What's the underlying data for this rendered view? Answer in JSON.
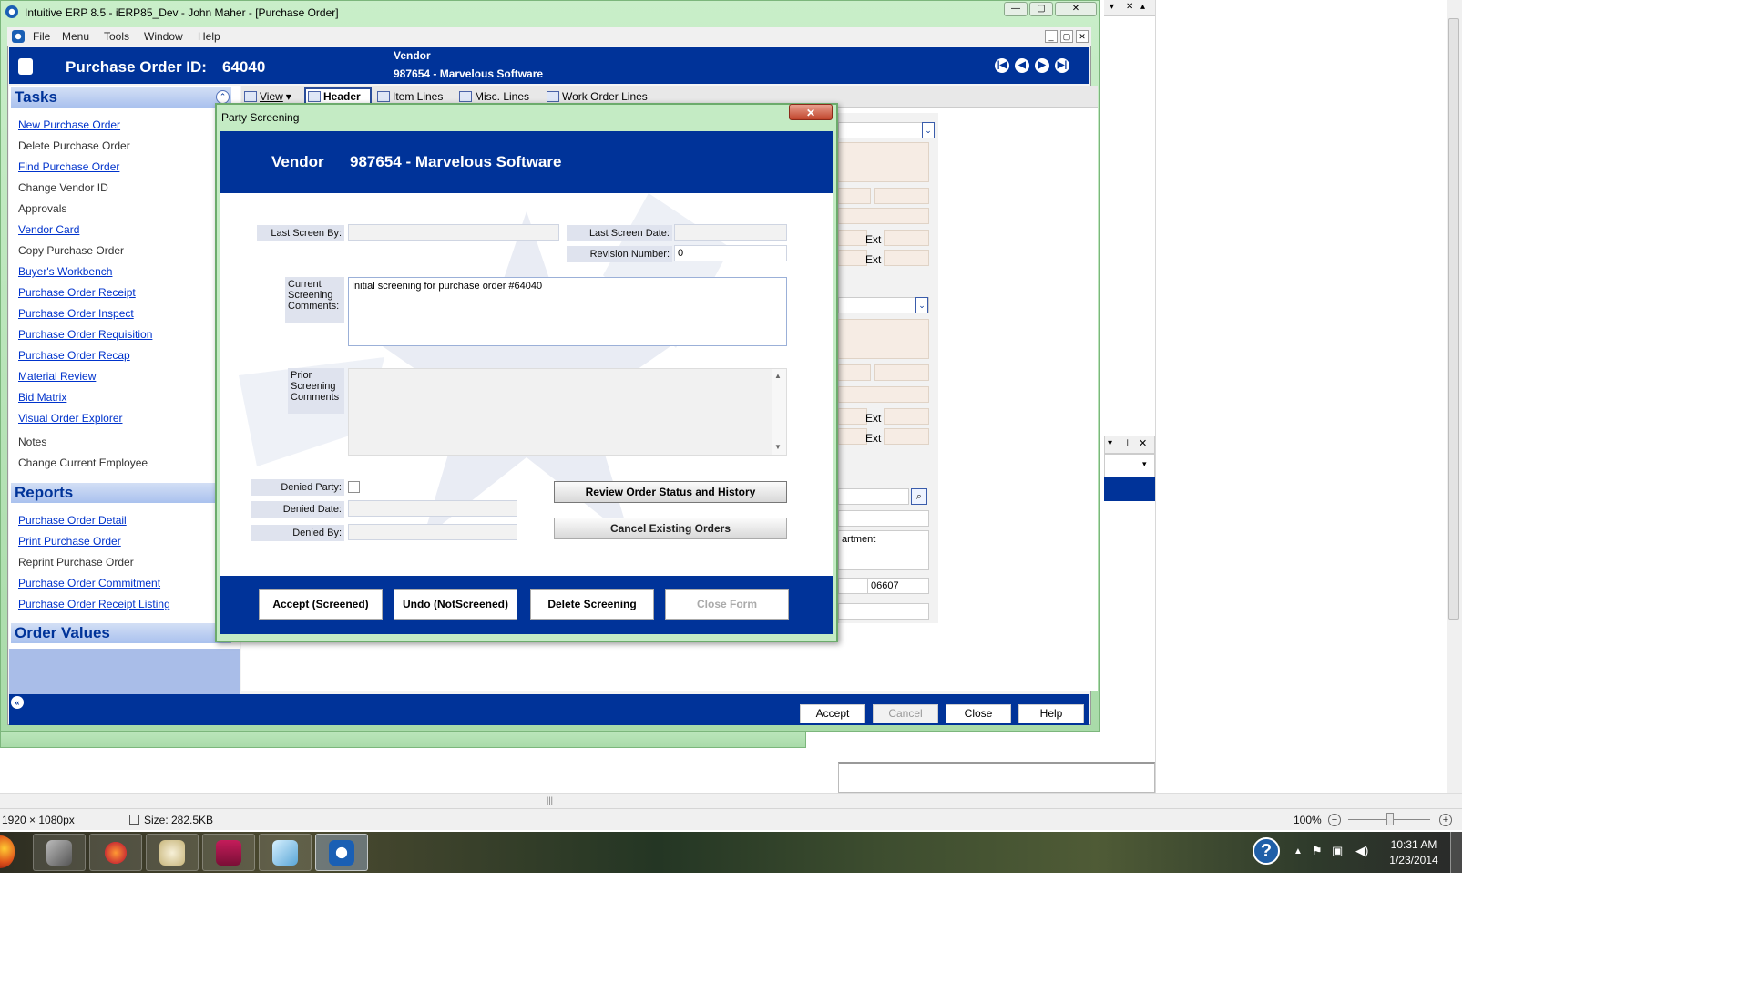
{
  "erp": {
    "window_title": "Intuitive ERP 8.5 - iERP85_Dev - John Maher - [Purchase Order]",
    "menu": [
      "File",
      "Menu",
      "Tools",
      "Window",
      "Help"
    ],
    "po_id_label": "Purchase Order ID:",
    "po_id": "64040",
    "vendor_label": "Vendor",
    "vendor_value": "987654 - Marvelous Software",
    "toolbar": {
      "view": "View"
    },
    "tabs": [
      "Header",
      "Item Lines",
      "Misc. Lines",
      "Work Order Lines"
    ],
    "background_fields": {
      "ext1": "Ext",
      "ext2": "Ext",
      "ext3": "Ext",
      "ext4": "Ext",
      "dept_partial": "artment",
      "zip": "06607"
    },
    "command_buttons": [
      "Accept",
      "Cancel",
      "Close",
      "Help"
    ]
  },
  "sidebar": {
    "tasks_title": "Tasks",
    "tasks": [
      {
        "label": "New Purchase Order",
        "link": true
      },
      {
        "label": "Delete Purchase Order",
        "link": false
      },
      {
        "label": "Find Purchase Order",
        "link": true
      },
      {
        "label": "Change Vendor ID",
        "link": false
      },
      {
        "label": "Approvals",
        "link": false
      },
      {
        "label": "Vendor Card",
        "link": true
      },
      {
        "label": "Copy Purchase Order",
        "link": false
      },
      {
        "label": "Buyer's Workbench",
        "link": true
      },
      {
        "label": "Purchase Order Receipt",
        "link": true
      },
      {
        "label": "Purchase Order Inspect",
        "link": true
      },
      {
        "label": "Purchase Order Requisition",
        "link": true
      },
      {
        "label": "Purchase Order Recap",
        "link": true
      },
      {
        "label": "Material Review",
        "link": true
      },
      {
        "label": "Bid Matrix",
        "link": true
      },
      {
        "label": "Visual Order Explorer",
        "link": true
      },
      {
        "label": "Notes",
        "link": false
      },
      {
        "label": "Change Current Employee",
        "link": false
      }
    ],
    "reports_title": "Reports",
    "reports": [
      {
        "label": "Purchase Order Detail",
        "link": true
      },
      {
        "label": "Print Purchase Order",
        "link": true
      },
      {
        "label": "Reprint Purchase Order",
        "link": false
      },
      {
        "label": "Purchase Order Commitment",
        "link": true
      },
      {
        "label": "Purchase Order Receipt Listing",
        "link": true
      }
    ],
    "order_values_title": "Order Values"
  },
  "dialog": {
    "title": "Party Screening",
    "close_glyph": "✕",
    "vendor_label": "Vendor",
    "vendor_value": "987654 - Marvelous Software",
    "last_screen_by_label": "Last Screen By:",
    "last_screen_by": "",
    "last_screen_date_label": "Last Screen Date:",
    "last_screen_date": "",
    "revision_number_label": "Revision Number:",
    "revision_number": "0",
    "current_comments_label": "Current Screening Comments:",
    "current_comments": "Initial screening for purchase order #64040",
    "prior_comments_label": "Prior Screening Comments",
    "prior_comments": "",
    "denied_party_label": "Denied Party:",
    "denied_party_checked": false,
    "denied_date_label": "Denied Date:",
    "denied_date": "",
    "denied_by_label": "Denied By:",
    "denied_by": "",
    "review_button": "Review Order Status and History",
    "cancel_orders_button": "Cancel Existing Orders",
    "footer_buttons": {
      "accept": "Accept (Screened)",
      "undo": "Undo (NotScreened)",
      "delete": "Delete Screening",
      "close": "Close Form"
    }
  },
  "paint": {
    "dimensions": "1920 × 1080px",
    "size": "Size: 282.5KB",
    "zoom": "100%"
  },
  "taskbar": {
    "time": "10:31 AM",
    "date": "1/23/2014"
  },
  "colors": {
    "brand_blue": "#003399",
    "window_green": "#b4e0b4",
    "link_blue": "#0033cc"
  }
}
